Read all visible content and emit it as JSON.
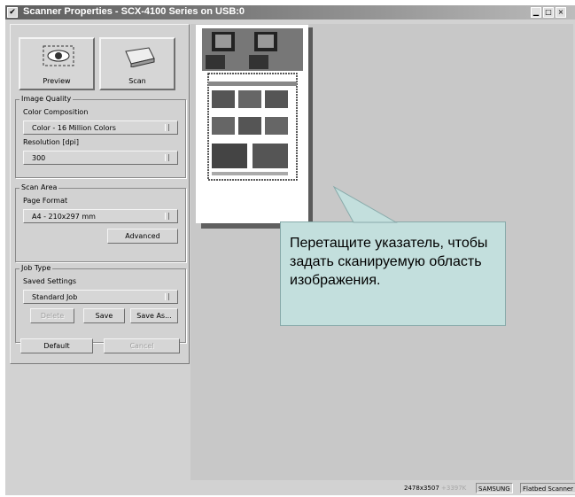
{
  "window": {
    "title": "Scanner Properties - SCX-4100 Series on USB:0",
    "menu_glyph": "✔",
    "minimize_glyph": "▁",
    "maximize_glyph": "□",
    "close_glyph": "×"
  },
  "toolbar": {
    "preview_label": "Preview",
    "scan_label": "Scan"
  },
  "image_quality": {
    "group_title": "Image Quality",
    "color_label": "Color Composition",
    "color_value": "Color - 16 Million Colors",
    "resolution_label": "Resolution [dpi]",
    "resolution_value": "300"
  },
  "scan_area": {
    "group_title": "Scan Area",
    "format_label": "Page Format",
    "format_value": "A4 - 210x297 mm",
    "advanced_label": "Advanced"
  },
  "job_type": {
    "group_title": "Job Type",
    "saved_label": "Saved Settings",
    "saved_value": "Standard Job",
    "delete_label": "Delete",
    "save_label": "Save",
    "save_as_label": "Save As..."
  },
  "footer_buttons": {
    "default_label": "Default",
    "cancel_label": "Cancel"
  },
  "callout": {
    "text": "Перетащите указатель, чтобы задать сканируемую область изображения."
  },
  "status": {
    "dimensions": "2478x3507",
    "size_dim": "+3397K",
    "vendor": "SAMSUNG",
    "device": "Flatbed Scanner"
  }
}
